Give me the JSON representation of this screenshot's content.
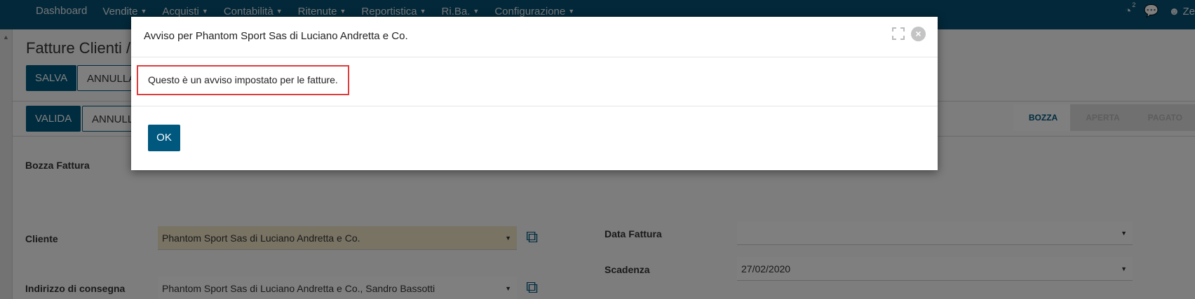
{
  "nav": {
    "items": [
      {
        "label": "Dashboard",
        "caret": false
      },
      {
        "label": "Vendite",
        "caret": true
      },
      {
        "label": "Acquisti",
        "caret": true
      },
      {
        "label": "Contabilità",
        "caret": true
      },
      {
        "label": "Ritenute",
        "caret": true
      },
      {
        "label": "Reportistica",
        "caret": true
      },
      {
        "label": "Ri.Ba.",
        "caret": true
      },
      {
        "label": "Configurazione",
        "caret": true
      }
    ],
    "notification_count": "2",
    "user_label": "Ze"
  },
  "page": {
    "breadcrumb": "Fatture Clienti /",
    "save_label": "SALVA",
    "cancel_label": "ANNULLA",
    "validate_label": "VALIDA",
    "cancel2_label": "ANNULLA",
    "status_steps": [
      {
        "label": "BOZZA",
        "active": true
      },
      {
        "label": "APERTA",
        "active": false
      },
      {
        "label": "PAGATO",
        "active": false
      }
    ],
    "draft_label": "Bozza Fattura",
    "customer_label": "Cliente",
    "customer_value": "Phantom Sport Sas di Luciano Andretta e Co.",
    "delivery_label": "Indirizzo di consegna",
    "delivery_value": "Phantom Sport Sas di Luciano Andretta e Co., Sandro Bassotti",
    "invoice_date_label": "Data Fattura",
    "invoice_date_value": "",
    "due_label": "Scadenza",
    "due_value": "27/02/2020"
  },
  "modal": {
    "title": "Avviso per Phantom Sport Sas di Luciano Andretta e Co.",
    "message": "Questo è un avviso impostato per le fatture.",
    "ok_label": "OK"
  },
  "colors": {
    "nav_bg": "#065073",
    "primary": "#00587f",
    "highlight_border": "#e03c3c",
    "customer_field_bg": "#f2e6c9"
  }
}
